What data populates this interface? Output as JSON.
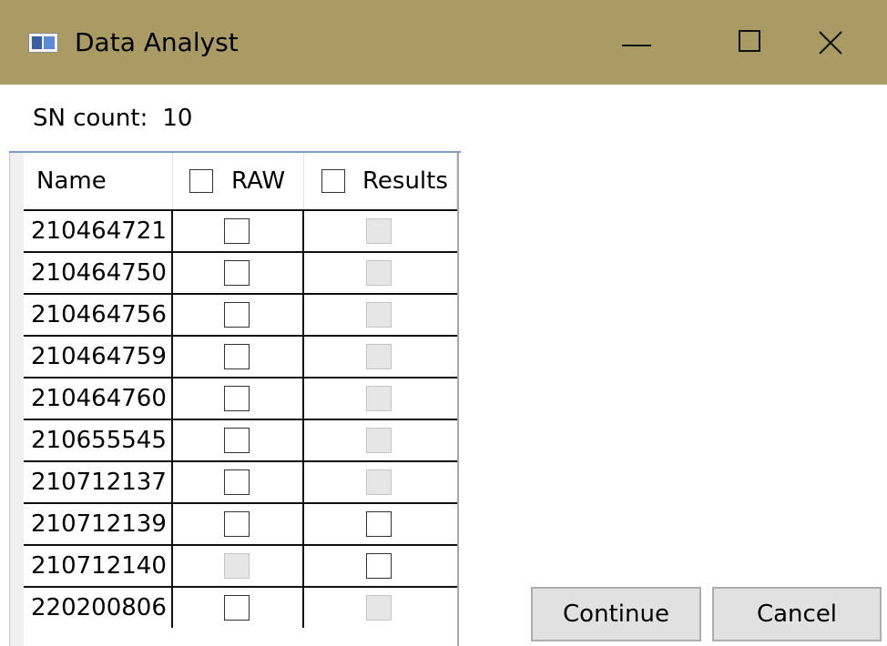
{
  "window": {
    "title": "Data Analyst",
    "icon": "app-window-icon",
    "controls": [
      "minimize-icon",
      "maximize-icon",
      "close-icon"
    ]
  },
  "sn_count": {
    "label": "SN count:",
    "value": "10"
  },
  "grid": {
    "columns": {
      "name": "Name",
      "raw": "RAW",
      "results": "Results"
    },
    "header_checks": {
      "raw": false,
      "results": false
    },
    "rows": [
      {
        "name": "210464721",
        "raw": {
          "checked": false,
          "enabled": true
        },
        "results": {
          "checked": false,
          "enabled": false
        }
      },
      {
        "name": "210464750",
        "raw": {
          "checked": false,
          "enabled": true
        },
        "results": {
          "checked": false,
          "enabled": false
        }
      },
      {
        "name": "210464756",
        "raw": {
          "checked": false,
          "enabled": true
        },
        "results": {
          "checked": false,
          "enabled": false
        }
      },
      {
        "name": "210464759",
        "raw": {
          "checked": false,
          "enabled": true
        },
        "results": {
          "checked": false,
          "enabled": false
        }
      },
      {
        "name": "210464760",
        "raw": {
          "checked": false,
          "enabled": true
        },
        "results": {
          "checked": false,
          "enabled": false
        }
      },
      {
        "name": "210655545",
        "raw": {
          "checked": false,
          "enabled": true
        },
        "results": {
          "checked": false,
          "enabled": false
        }
      },
      {
        "name": "210712137",
        "raw": {
          "checked": false,
          "enabled": true
        },
        "results": {
          "checked": false,
          "enabled": false
        }
      },
      {
        "name": "210712139",
        "raw": {
          "checked": false,
          "enabled": true
        },
        "results": {
          "checked": false,
          "enabled": true
        }
      },
      {
        "name": "210712140",
        "raw": {
          "checked": false,
          "enabled": false
        },
        "results": {
          "checked": false,
          "enabled": true
        }
      },
      {
        "name": "220200806",
        "raw": {
          "checked": false,
          "enabled": true
        },
        "results": {
          "checked": false,
          "enabled": false
        }
      }
    ]
  },
  "buttons": {
    "continue": "Continue",
    "cancel": "Cancel"
  },
  "colors": {
    "titlebar": "#aa9a64",
    "grid_header_border": "#7d9ec0",
    "disabled_checkbox": "#e6e6e6",
    "button_face": "#e1e1e1"
  }
}
